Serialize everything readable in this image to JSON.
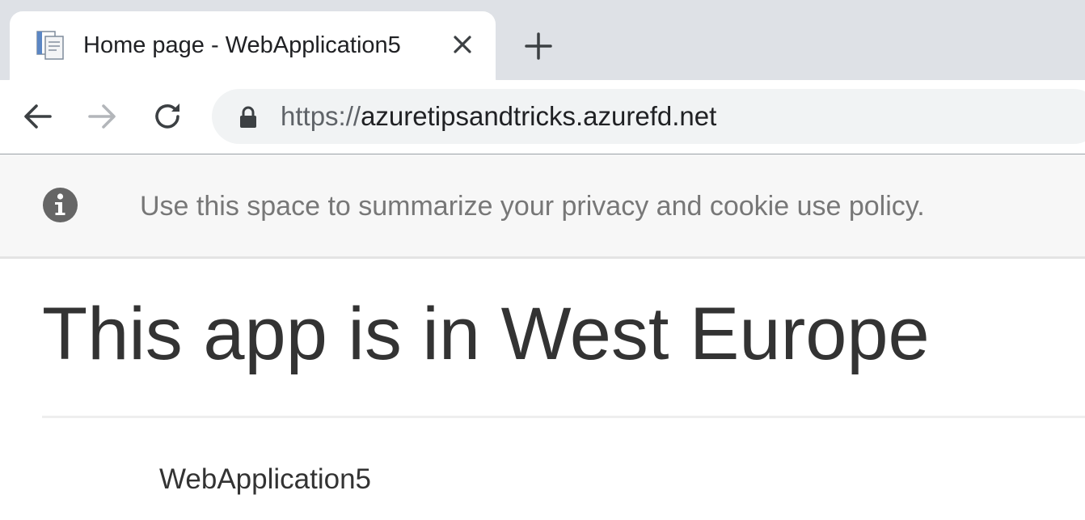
{
  "browser": {
    "tab": {
      "title": "Home page - WebApplication5",
      "favicon": "document-favicon-icon",
      "close_icon": "close-icon"
    },
    "new_tab_icon": "plus-icon",
    "nav": {
      "back_icon": "back-arrow-icon",
      "forward_icon": "forward-arrow-icon",
      "reload_icon": "reload-icon"
    },
    "address_bar": {
      "scheme": "https://",
      "host": "azuretipsandtricks.azurefd.net",
      "lock_icon": "lock-icon"
    }
  },
  "cookie_consent": {
    "icon": "info-icon",
    "message": "Use this space to summarize your privacy and cookie use policy."
  },
  "main": {
    "heading": "This app is in West Europe",
    "app_name": "WebApplication5"
  },
  "colors": {
    "tabstrip_bg": "#dee1e6",
    "omnibox_bg": "#f1f3f4",
    "cookie_bar_bg": "#f7f7f7",
    "text_dark": "#333333",
    "text_muted": "#777777"
  }
}
